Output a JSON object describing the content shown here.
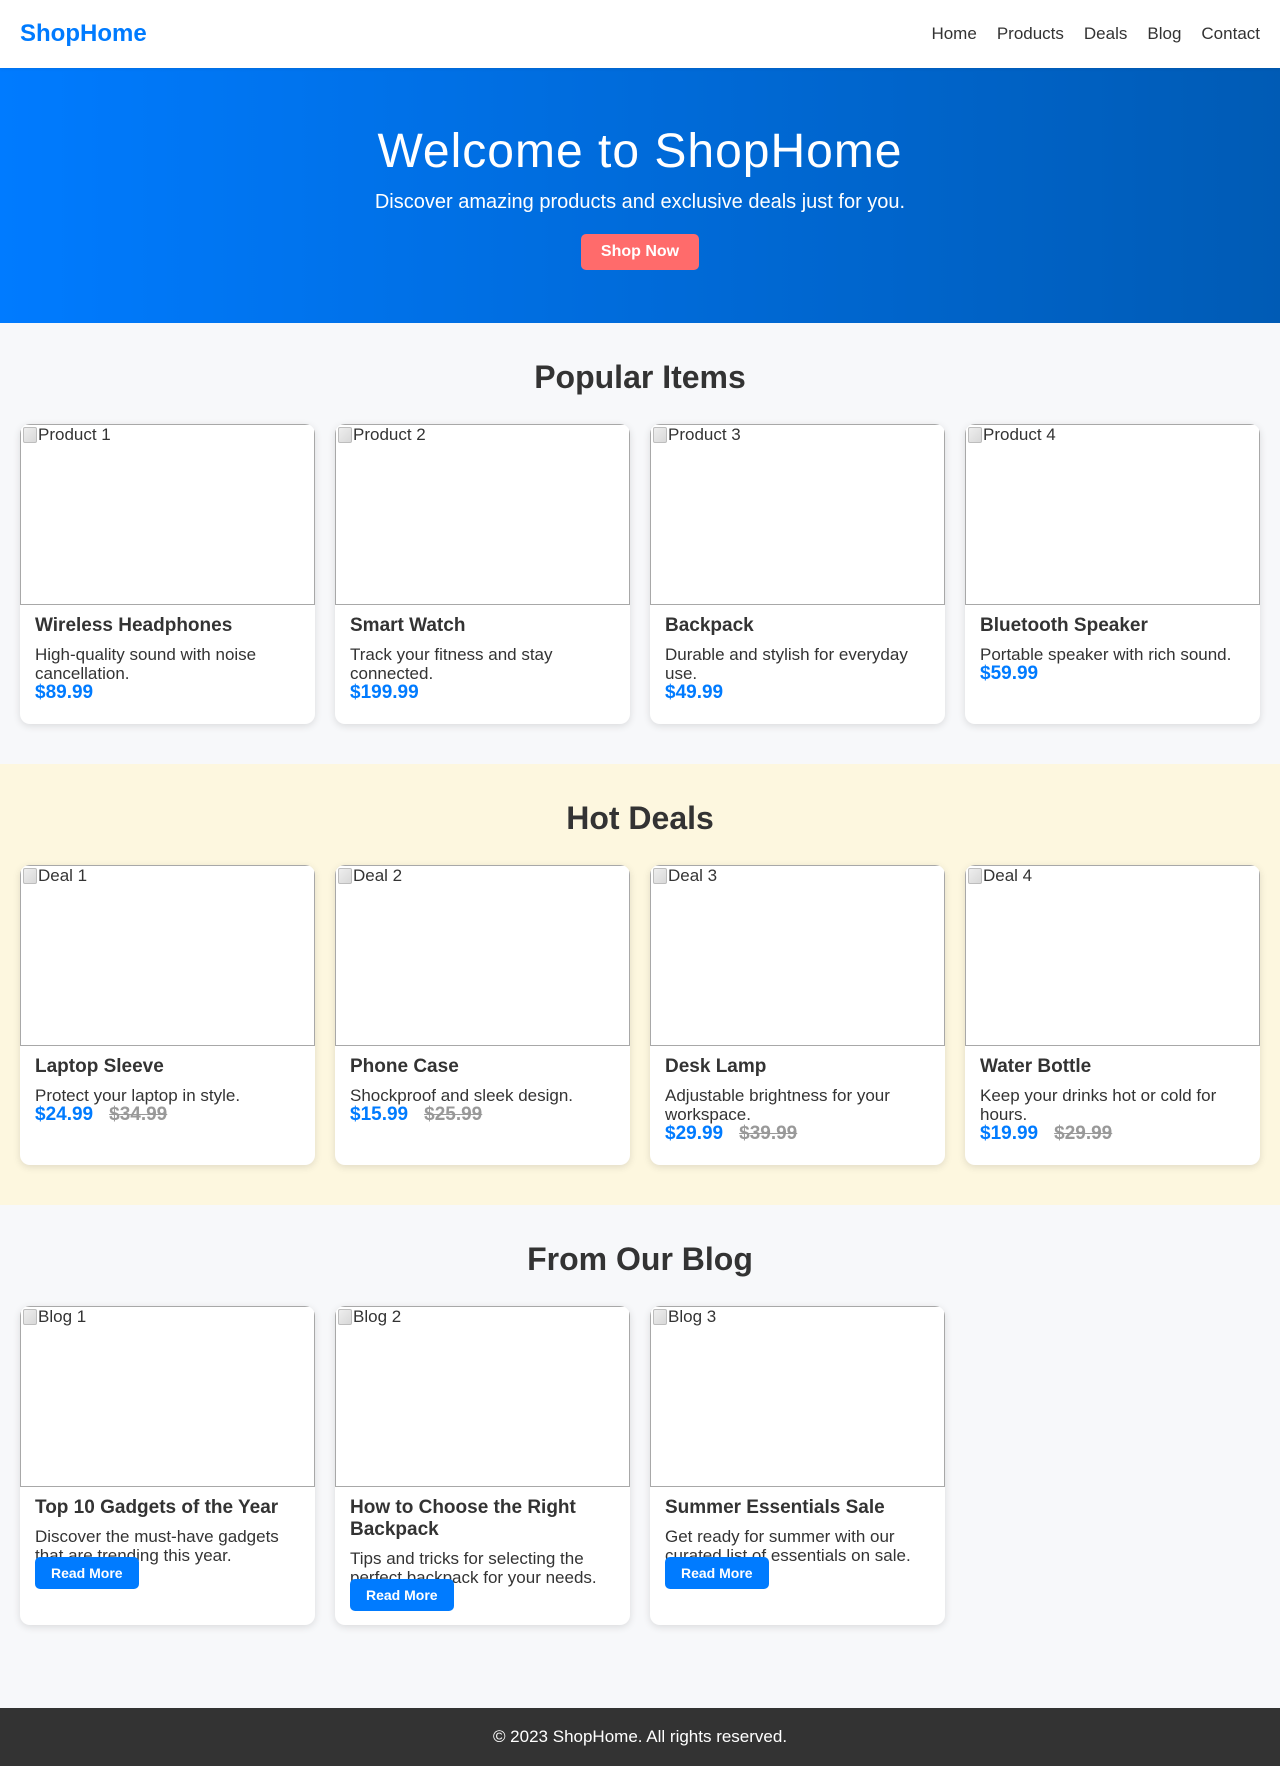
{
  "header": {
    "brand": "ShopHome",
    "nav": [
      "Home",
      "Products",
      "Deals",
      "Blog",
      "Contact"
    ]
  },
  "hero": {
    "title": "Welcome to ShopHome",
    "subtitle": "Discover amazing products and exclusive deals just for you.",
    "cta": "Shop Now"
  },
  "popular": {
    "title": "Popular Items",
    "items": [
      {
        "img_alt": "Product 1",
        "name": "Wireless Headphones",
        "desc": "High-quality sound with noise cancellation.",
        "price": "$89.99"
      },
      {
        "img_alt": "Product 2",
        "name": "Smart Watch",
        "desc": "Track your fitness and stay connected.",
        "price": "$199.99"
      },
      {
        "img_alt": "Product 3",
        "name": "Backpack",
        "desc": "Durable and stylish for everyday use.",
        "price": "$49.99"
      },
      {
        "img_alt": "Product 4",
        "name": "Bluetooth Speaker",
        "desc": "Portable speaker with rich sound.",
        "price": "$59.99"
      }
    ]
  },
  "deals": {
    "title": "Hot Deals",
    "items": [
      {
        "img_alt": "Deal 1",
        "name": "Laptop Sleeve",
        "desc": "Protect your laptop in style.",
        "price": "$24.99",
        "old_price": "$34.99"
      },
      {
        "img_alt": "Deal 2",
        "name": "Phone Case",
        "desc": "Shockproof and sleek design.",
        "price": "$15.99",
        "old_price": "$25.99"
      },
      {
        "img_alt": "Deal 3",
        "name": "Desk Lamp",
        "desc": "Adjustable brightness for your workspace.",
        "price": "$29.99",
        "old_price": "$39.99"
      },
      {
        "img_alt": "Deal 4",
        "name": "Water Bottle",
        "desc": "Keep your drinks hot or cold for hours.",
        "price": "$19.99",
        "old_price": "$29.99"
      }
    ]
  },
  "blog": {
    "title": "From Our Blog",
    "read_more": "Read More",
    "items": [
      {
        "img_alt": "Blog 1",
        "name": "Top 10 Gadgets of the Year",
        "desc": "Discover the must-have gadgets that are trending this year."
      },
      {
        "img_alt": "Blog 2",
        "name": "How to Choose the Right Backpack",
        "desc": "Tips and tricks for selecting the perfect backpack for your needs."
      },
      {
        "img_alt": "Blog 3",
        "name": "Summer Essentials Sale",
        "desc": "Get ready for summer with our curated list of essentials on sale."
      }
    ]
  },
  "footer": {
    "text": "© 2023 ShopHome. All rights reserved."
  },
  "colors": {
    "brand": "#007bff",
    "cta": "#ff6b6b",
    "deals_bg": "#fdf7df",
    "footer_bg": "#333333"
  }
}
